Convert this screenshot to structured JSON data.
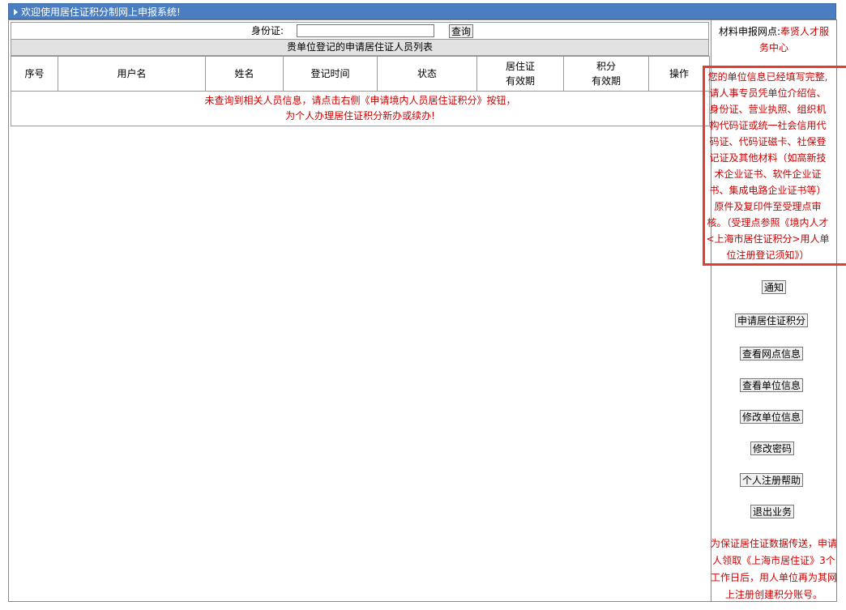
{
  "header": {
    "title": "欢迎使用居住证积分制网上申报系统!"
  },
  "search": {
    "label": "身份证:",
    "value": "",
    "placeholder": "",
    "button": "查询"
  },
  "list": {
    "title": "贵单位登记的申请居住证人员列表",
    "columns": [
      {
        "line1": "序号",
        "line2": ""
      },
      {
        "line1": "用户名",
        "line2": ""
      },
      {
        "line1": "姓名",
        "line2": ""
      },
      {
        "line1": "登记时间",
        "line2": ""
      },
      {
        "line1": "状态",
        "line2": ""
      },
      {
        "line1": "居住证",
        "line2": "有效期"
      },
      {
        "line1": "积分",
        "line2": "有效期"
      },
      {
        "line1": "操作",
        "line2": ""
      }
    ],
    "empty_line1": "未查询到相关人员信息，请点击右侧《申请境内人员居住证积分》按钮，",
    "empty_line2": "为个人办理居住证积分新办或续办!"
  },
  "sidebar": {
    "net_label": "材料申报网点:",
    "net_value": "奉贤人才服务中心",
    "notice": "您的单位信息已经填写完整,请人事专员凭单位介绍信、身份证、营业执照、组织机构代码证或统一社会信用代码证、代码证磁卡、社保登记证及其他材料（如高新技术企业证书、软件企业证书、集成电路企业证书等）原件及复印件至受理点审核。（受理点参照《境内人才<上海市居住证积分>用人单位注册登记须知》）",
    "buttons": {
      "notify": "通知",
      "apply": "申请居住证积分",
      "view_net": "查看网点信息",
      "view_unit": "查看单位信息",
      "edit_unit": "修改单位信息",
      "change_pwd": "修改密码",
      "reg_help": "个人注册帮助",
      "logout": "退出业务"
    },
    "footnote": "为保证居住证数据传送，申请人领取《上海市居住证》3个工作日后，用人单位再为其网上注册创建积分账号。"
  },
  "colors": {
    "header_bg": "#4a7ec0",
    "alert_red": "#cc0000",
    "highlight_box": "#e53a2e"
  }
}
